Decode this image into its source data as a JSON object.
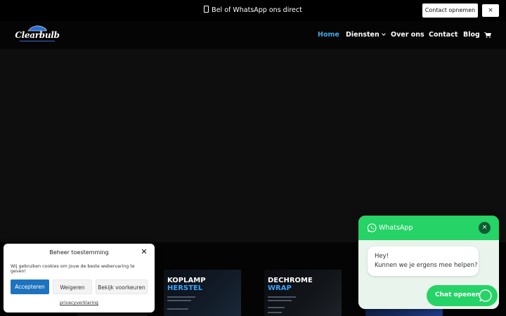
{
  "topbar": {
    "message": "Bel of WhatsApp ons direct",
    "contact_button": "Contact opnemen",
    "close_label": "×"
  },
  "header": {
    "logo_text": "Clearbulb",
    "nav": [
      {
        "label": "Home",
        "active": true
      },
      {
        "label": "Diensten",
        "has_dropdown": true
      },
      {
        "label": "Over ons"
      },
      {
        "label": "Contact"
      },
      {
        "label": "Blog"
      }
    ],
    "cart_icon": "cart-icon"
  },
  "cards": [
    {
      "title_line1": "KOPLAMP",
      "title_line2": "HERSTEL"
    },
    {
      "title_line1": "DECHROME",
      "title_line2": "WRAP"
    }
  ],
  "cookie": {
    "title": "Beheer toestemming",
    "description": "Wij gebruiken cookies om jouw de beste webervaring te geven!",
    "accept": "Accepteren",
    "deny": "Weigeren",
    "preferences": "Bekijk voorkeuren",
    "privacy_link": "privacyverklaring"
  },
  "whatsapp": {
    "title": "WhatsApp",
    "close_label": "×",
    "message_line1": "Hey!",
    "message_line2": "Kunnen we je ergens mee helpen?",
    "open_button": "Chat openen"
  },
  "colors": {
    "accent_nav": "#3fa9e6",
    "whatsapp_green": "#25d366",
    "accept_blue": "#1e73be"
  }
}
